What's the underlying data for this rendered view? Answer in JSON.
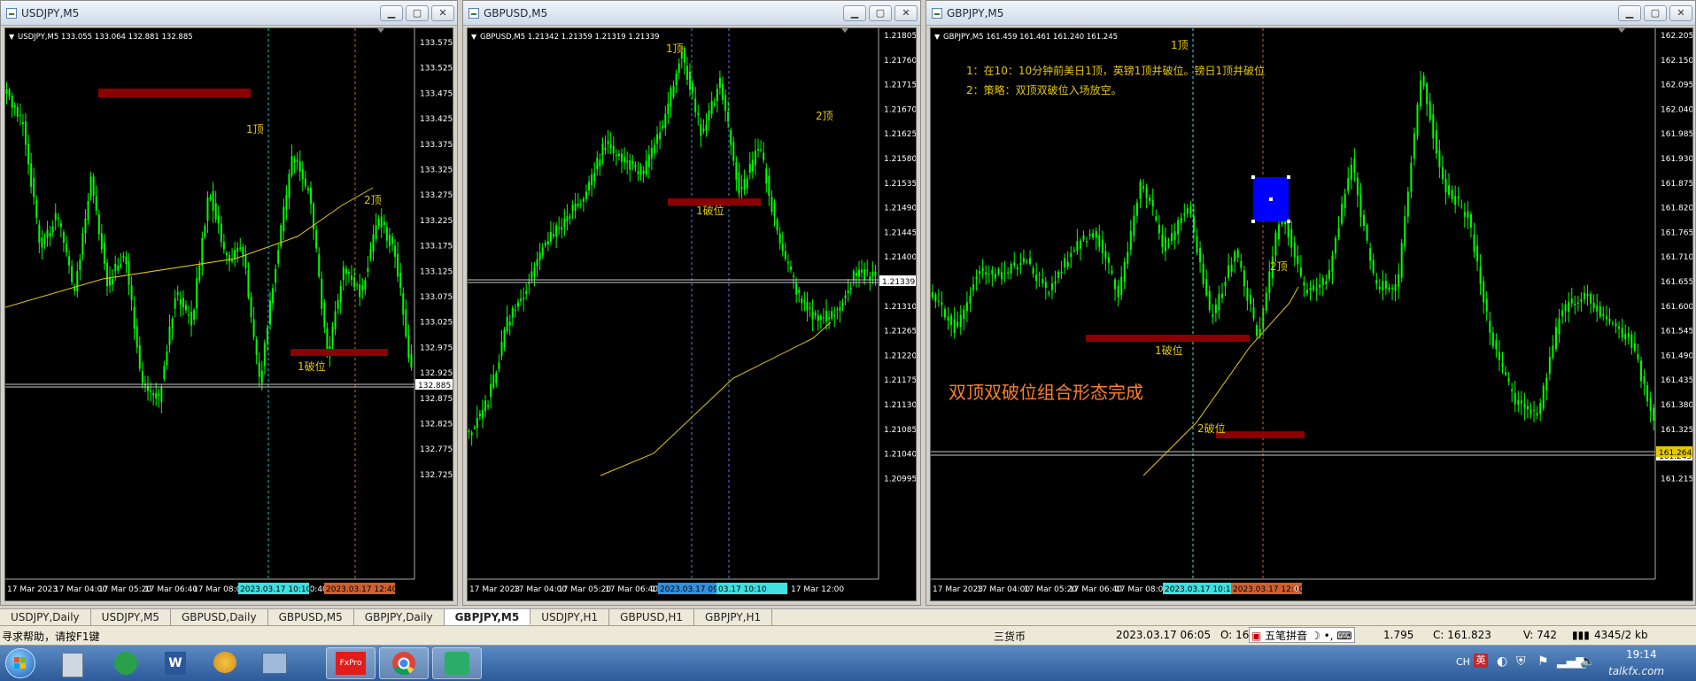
{
  "windows": [
    {
      "title": "USDJPY,M5",
      "info": "USDJPY,M5  133.055 133.064 132.881 132.885",
      "price_labels": [
        "133.575",
        "133.525",
        "133.475",
        "133.425",
        "133.375",
        "133.325",
        "133.275",
        "133.225",
        "133.175",
        "133.125",
        "133.075",
        "133.025",
        "132.975",
        "132.925",
        "132.875",
        "132.825",
        "132.775",
        "132.725"
      ],
      "current_price": "132.885",
      "time_labels": [
        "17 Mar 2023",
        "17 Mar 04:00",
        "17 Mar 05:20",
        "17 Mar 06:40",
        "17 Mar 08:00",
        "Mar 10:40"
      ],
      "time_highlight_1": "2023.03.17 10:10",
      "time_highlight_2": "2023.03.17 12:40",
      "annotations": [
        "1顶",
        "2顶",
        "1破位"
      ]
    },
    {
      "title": "GBPUSD,M5",
      "info": "GBPUSD,M5  1.21342 1.21359 1.21319 1.21339",
      "price_labels": [
        "1.21805",
        "1.21760",
        "1.21715",
        "1.21670",
        "1.21625",
        "1.21580",
        "1.21535",
        "1.21490",
        "1.21445",
        "1.21400",
        "1.21355",
        "1.21310",
        "1.21265",
        "1.21220",
        "1.21175",
        "1.21130",
        "1.21085",
        "1.21040",
        "1.20995"
      ],
      "current_price": "1.21339",
      "time_labels": [
        "17 Mar 2023",
        "17 Mar 04:00",
        "17 Mar 05:20",
        "17 Mar 06:40",
        "17",
        "Mar 10:40",
        "17 Mar 12:00"
      ],
      "time_highlight_1": "2023.03.17 09:05",
      "time_highlight_2": "03.17 10:10",
      "annotations": [
        "1顶",
        "2顶",
        "1破位"
      ]
    },
    {
      "title": "GBPJPY,M5",
      "info": "GBPJPY,M5  161.459 161.461 161.240 161.245",
      "price_labels": [
        "162.205",
        "162.150",
        "162.095",
        "162.040",
        "161.985",
        "161.930",
        "161.875",
        "161.820",
        "161.765",
        "161.710",
        "161.655",
        "161.600",
        "161.545",
        "161.490",
        "161.435",
        "161.380",
        "161.325",
        "161.270",
        "161.215"
      ],
      "current_price": "161.245",
      "level_price": "161.264",
      "time_labels": [
        "17 Mar 2023",
        "17 Mar 04:00",
        "17 Mar 05:20",
        "17 Mar 06:40",
        "17 Mar 08:00",
        "Mar"
      ],
      "time_highlight_1": "2023.03.17 10:10",
      "time_highlight_2": "2023.03.17 12:10",
      "time_tail": "0",
      "note_line1": "1：在10：10分钟前美日1顶，英镑1顶并破位。镑日1顶并破位",
      "note_line2": "2：策略：双顶双破位入场放空。",
      "big_text": "双顶双破位组合形态完成",
      "annotations": [
        "1顶",
        "2顶",
        "1破位",
        "2破位"
      ]
    }
  ],
  "tabs": [
    "USDJPY,Daily",
    "USDJPY,M5",
    "GBPUSD,Daily",
    "GBPUSD,M5",
    "GBPJPY,Daily",
    "GBPJPY,M5",
    "USDJPY,H1",
    "GBPUSD,H1",
    "GBPJPY,H1"
  ],
  "active_tab": "GBPJPY,M5",
  "status": {
    "help": "寻求帮助，请按F1键",
    "profile": "三货币",
    "datetime": "2023.03.17 06:05",
    "open": "O: 16",
    "ime": "五笔拼音",
    "high": "1.795",
    "close": "C: 161.823",
    "volume": "V: 742",
    "traffic": "4345/2 kb"
  },
  "taskbar": {
    "fxpro": "FxPro",
    "lang": "CH",
    "clock": "19:14",
    "watermark": "talkfx.com"
  },
  "colors": {
    "candle": "#00ff00",
    "ma": "#e6c800",
    "zone": "#8b0000",
    "label": "#e6c800",
    "big_text": "#ff7f27",
    "rect": "#0000ff"
  }
}
